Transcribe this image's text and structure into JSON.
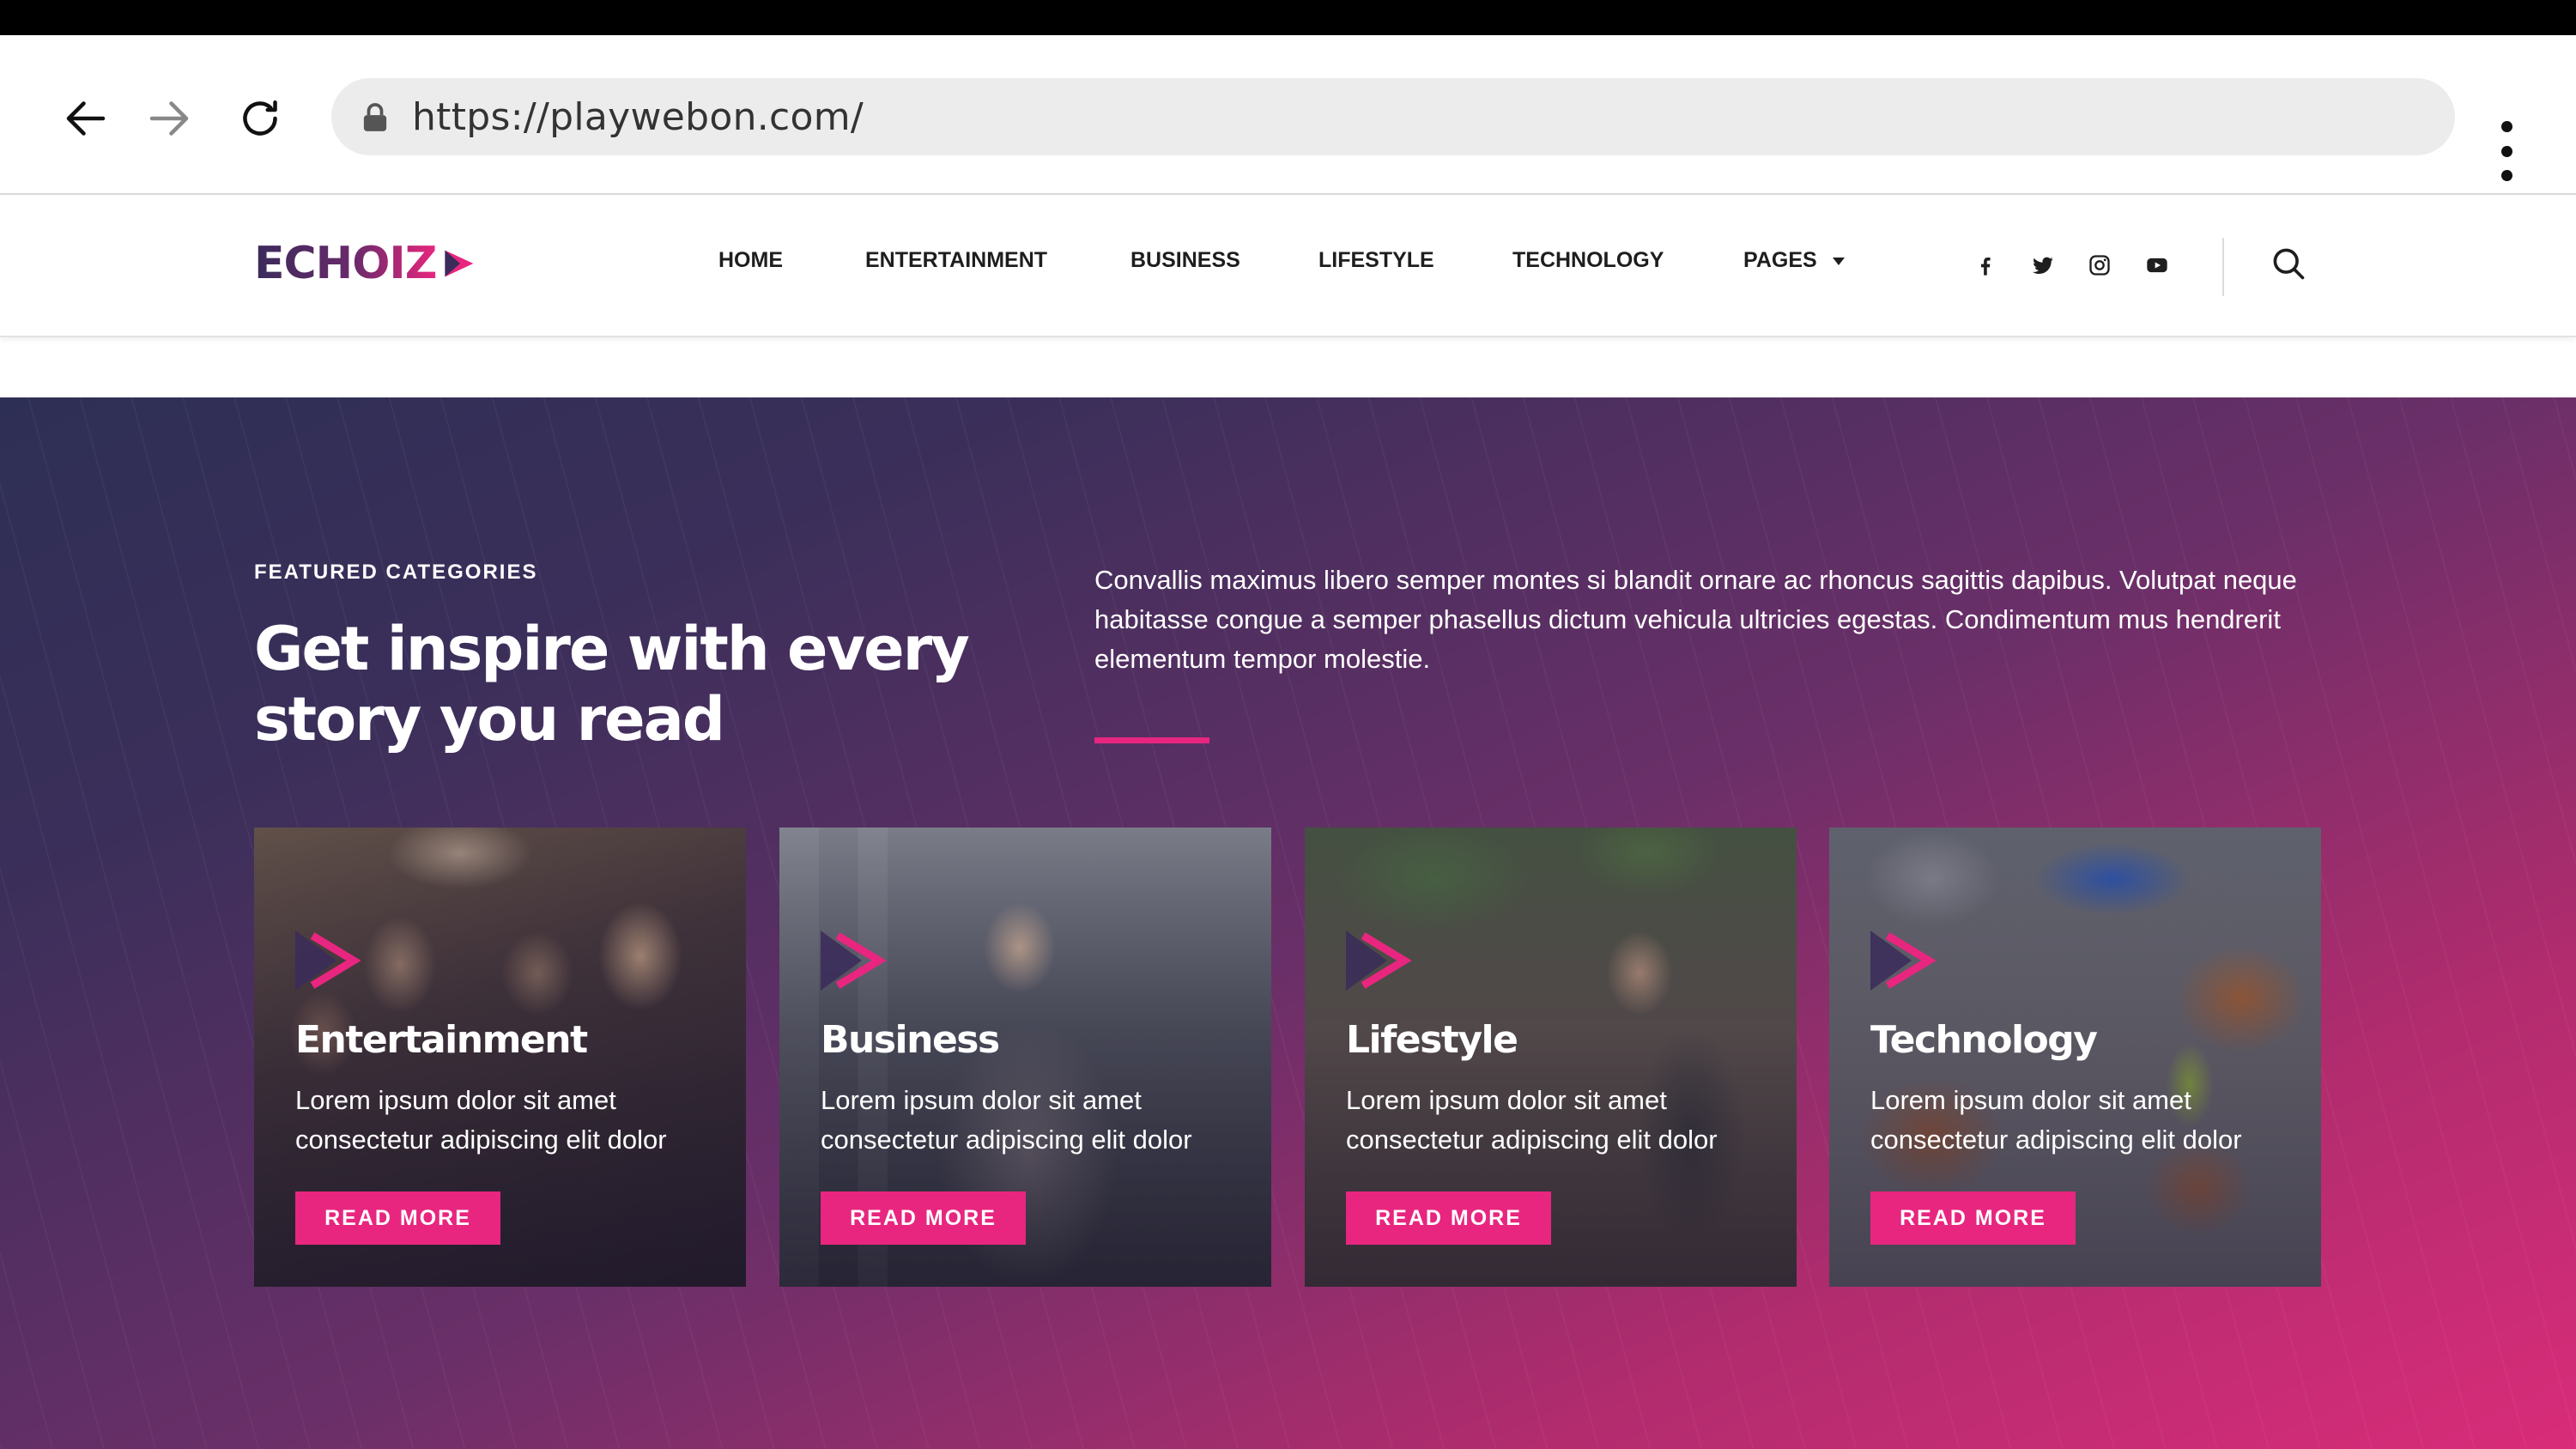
{
  "browser": {
    "url": "https://playwebon.com/",
    "icons": [
      "back-arrow-icon",
      "forward-arrow-icon",
      "reload-icon",
      "lock-icon",
      "more-vert-icon"
    ]
  },
  "header": {
    "logo_text": "ECHOIZ",
    "nav": [
      {
        "label": "HOME"
      },
      {
        "label": "ENTERTAINMENT"
      },
      {
        "label": "BUSINESS"
      },
      {
        "label": "LIFESTYLE"
      },
      {
        "label": "TECHNOLOGY"
      },
      {
        "label": "PAGES"
      }
    ],
    "social_icons": [
      "facebook-icon",
      "twitter-icon",
      "instagram-icon",
      "youtube-icon"
    ],
    "search_icon": "search-icon"
  },
  "featured": {
    "eyebrow": "FEATURED CATEGORIES",
    "heading_line1": "Get inspire with every",
    "heading_line2": "story you read",
    "intro": "Convallis maximus libero semper montes si blandit ornare ac rhoncus sagittis dapibus. Volutpat neque habitasse congue a semper phasellus dictum vehicula ultricies egestas. Condimentum mus hendrerit elementum tempor molestie.",
    "cards": [
      {
        "title": "Entertainment",
        "desc": "Lorem ipsum dolor sit amet consectetur adipiscing elit dolor",
        "button": "READ MORE"
      },
      {
        "title": "Business",
        "desc": "Lorem ipsum dolor sit amet consectetur adipiscing elit dolor",
        "button": "READ MORE"
      },
      {
        "title": "Lifestyle",
        "desc": "Lorem ipsum dolor sit amet consectetur adipiscing elit dolor",
        "button": "READ MORE"
      },
      {
        "title": "Technology",
        "desc": "Lorem ipsum dolor sit amet consectetur adipiscing elit dolor",
        "button": "READ MORE"
      }
    ]
  },
  "colors": {
    "accent": "#e8267f",
    "dark_navy": "#2e2f55",
    "brand_purple": "#3a2b5a"
  }
}
